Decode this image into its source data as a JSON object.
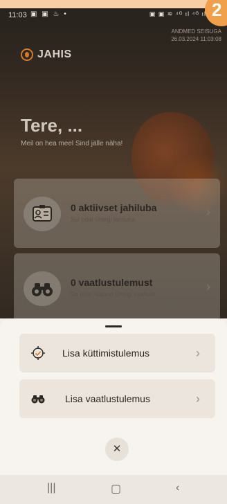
{
  "status": {
    "time": "11:03",
    "left_icons": "▣ ▣ ♨ •",
    "right_icons": "▣ ▣ ≋ ⁴ᴳ ıl ⁴ᴳ ıl"
  },
  "corner_badge": "2",
  "sync": {
    "line1": "ANDMED SEISUGA",
    "line2": "26.03.2024 11:03:08"
  },
  "brand": {
    "name": "JAHIS"
  },
  "greeting": {
    "title": "Tere, ...",
    "subtitle": "Meil on hea meel Sind jälle näha!"
  },
  "cards": [
    {
      "title": "0 aktiivset jahiluba",
      "subtitle": "Sul pole ühtegi jahiluba",
      "icon": "id-card-icon"
    },
    {
      "title": "0 vaatlustulemust",
      "subtitle": "Sa pole lisanud ühtegi vaatlust",
      "icon": "binoculars-icon"
    }
  ],
  "sheet": {
    "options": [
      {
        "label": "Lisa küttimistulemus",
        "icon": "crosshair-icon"
      },
      {
        "label": "Lisa vaatlustulemus",
        "icon": "binoculars-icon"
      }
    ],
    "close": "✕"
  },
  "nav": {
    "recent": "|||",
    "home": "▢",
    "back": "‹"
  },
  "colors": {
    "accent": "#d47a2e",
    "sheet_bg": "#f7f4f0",
    "option_bg": "#ece5de"
  }
}
